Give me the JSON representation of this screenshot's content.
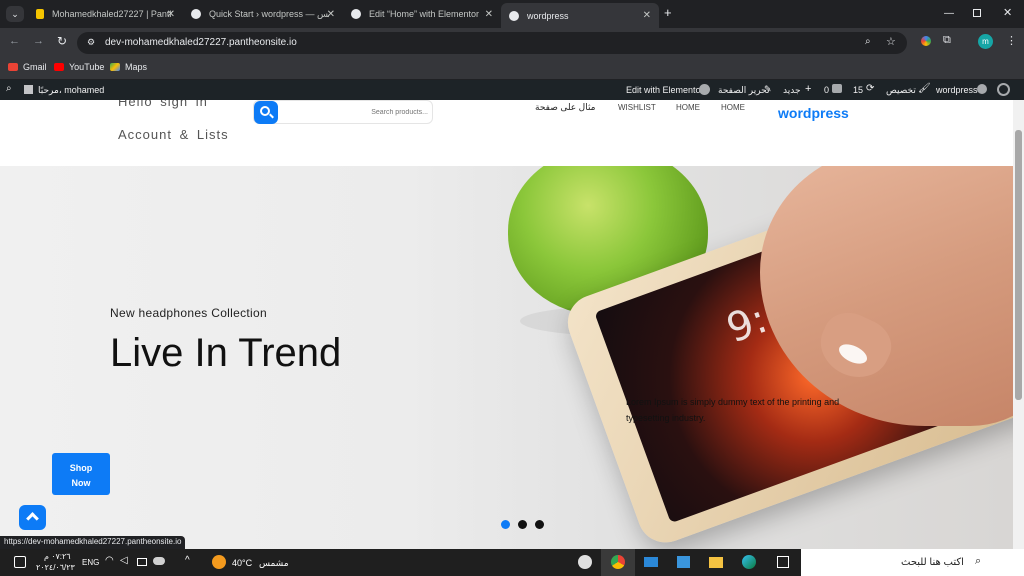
{
  "browser": {
    "tabs": [
      {
        "title": "Mohamedkhaled27227 | Panthe",
        "active": false
      },
      {
        "title": "Quick Start › wordpress — ووردبريس",
        "active": false
      },
      {
        "title": "Edit “Home” with Elementor",
        "active": false
      },
      {
        "title": "wordpress",
        "active": true
      }
    ],
    "url": "dev-mohamedkhaled27227.pantheonsite.io",
    "profile_initial": "m",
    "bookmarks": [
      "Gmail",
      "YouTube",
      "Maps"
    ]
  },
  "admin_bar": {
    "site": "wordpress",
    "customize": "تخصيص",
    "updates": "15",
    "comments": "0",
    "new": "جديد",
    "edit_page": "تحرير الصفحة",
    "edit_elementor": "Edit with Elementor",
    "greeting": "مرحبًا، mohamed"
  },
  "site": {
    "logo": "wordpress",
    "nav": [
      "HOME",
      "HOME",
      "WISHLIST",
      "مثال على صفحة"
    ],
    "search_placeholder": "Search products...",
    "account_line1": "Hello sign in",
    "account_line2": "Account & Lists"
  },
  "hero": {
    "eyebrow": "New headphones Collection",
    "title": "Live In Trend",
    "description": "Lorem Ipsum is simply dummy text of the printing and typesetting industry.",
    "cta": "Shop Now",
    "slides": 3,
    "active_slide": 0,
    "phone_time": "9:57"
  },
  "status_url": "https://dev-mohamedkhaled27227.pantheonsite.io",
  "taskbar": {
    "search": "اكتب هنا للبحث",
    "weather_temp": "40°C",
    "weather_desc": "مشمس",
    "lang": "ENG",
    "time": "٠٧:٢٦ م",
    "date": "٢٠٢٤/٠٦/٢٣"
  },
  "colors": {
    "accent": "#0d7bf6",
    "admin_bar": "#1d2327",
    "apple": "#8bc73a"
  }
}
